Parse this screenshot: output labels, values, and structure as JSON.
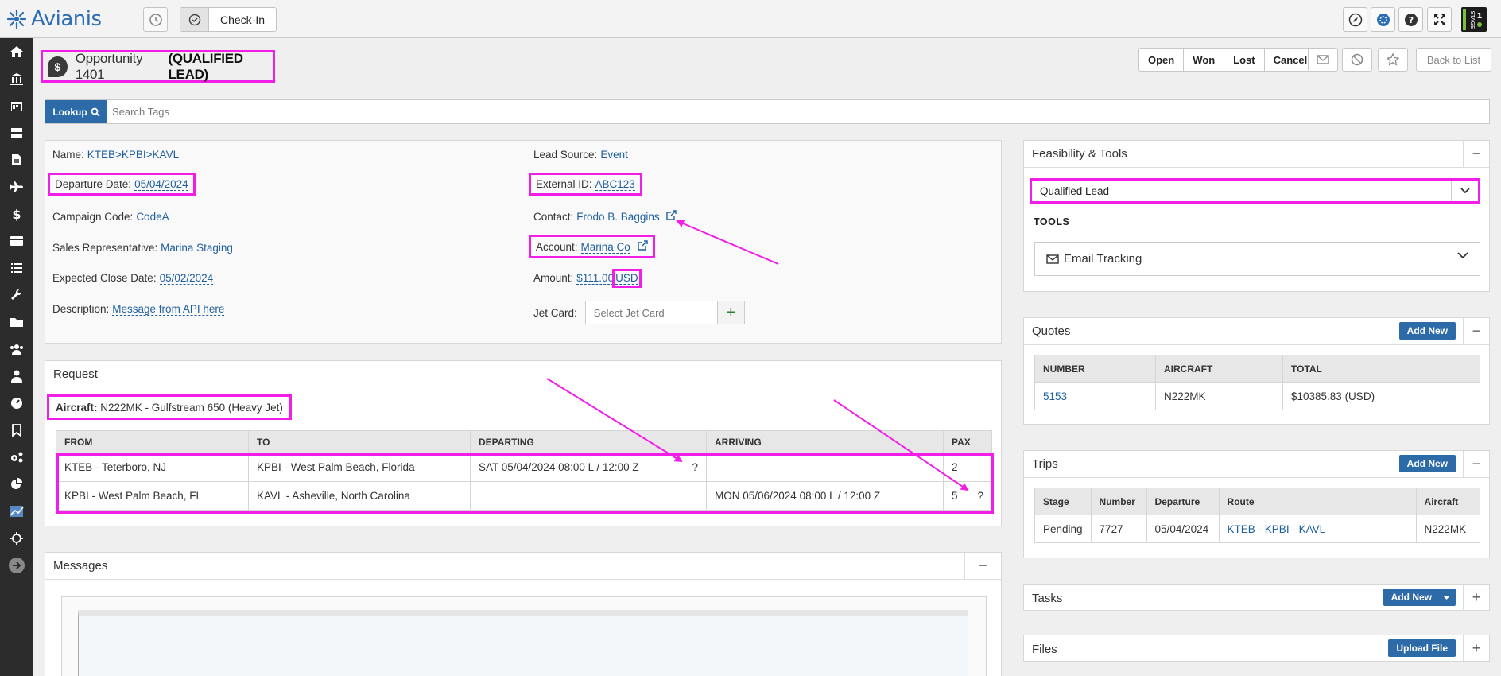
{
  "app": {
    "brand": "Avianis",
    "checkin_tab": "Check-In",
    "stage_badge": "STAGE",
    "stage_badge_number": "1"
  },
  "header": {
    "title_prefix": "Opportunity 1401",
    "title_status": "(QUALIFIED LEAD)",
    "status_buttons": [
      "Open",
      "Won",
      "Lost",
      "Cancel"
    ],
    "back_label": "Back to List"
  },
  "search": {
    "lookup_label": "Lookup",
    "placeholder": "Search Tags"
  },
  "details": {
    "name": {
      "label": "Name:",
      "value": "KTEB>KPBI>KAVL"
    },
    "departure_date": {
      "label": "Departure Date:",
      "value": "05/04/2024"
    },
    "campaign_code": {
      "label": "Campaign Code:",
      "value": "CodeA"
    },
    "sales_rep": {
      "label": "Sales Representative:",
      "value": "Marina Staging"
    },
    "expected_close": {
      "label": "Expected Close Date:",
      "value": "05/02/2024"
    },
    "description": {
      "label": "Description:",
      "value": "Message from API here"
    },
    "lead_source": {
      "label": "Lead Source:",
      "value": "Event"
    },
    "external_id": {
      "label": "External ID:",
      "value": "ABC123"
    },
    "contact": {
      "label": "Contact:",
      "value": "Frodo B. Baggins"
    },
    "account": {
      "label": "Account:",
      "value": "Marina Co"
    },
    "amount": {
      "label": "Amount:",
      "value": "$111.00",
      "currency": "USD"
    },
    "jet_card": {
      "label": "Jet Card:",
      "placeholder": "Select Jet Card"
    }
  },
  "request": {
    "title": "Request",
    "aircraft_label": "Aircraft:",
    "aircraft_value": "N222MK - Gulfstream 650 (Heavy Jet)",
    "columns": [
      "FROM",
      "TO",
      "DEPARTING",
      "ARRIVING",
      "PAX"
    ],
    "rows": [
      {
        "from": "KTEB - Teterboro, NJ",
        "to": "KPBI - West Palm Beach, Florida",
        "departing": "SAT 05/04/2024 08:00 L / 12:00 Z",
        "departing_flag": "?",
        "arriving": "",
        "pax": "2",
        "pax_flag": ""
      },
      {
        "from": "KPBI - West Palm Beach, FL",
        "to": "KAVL - Asheville, North Carolina",
        "departing": "",
        "departing_flag": "",
        "arriving": "MON 05/06/2024 08:00 L / 12:00 Z",
        "pax": "5",
        "pax_flag": "?"
      }
    ]
  },
  "messages": {
    "title": "Messages"
  },
  "feasibility": {
    "title": "Feasibility & Tools",
    "selected": "Qualified Lead",
    "tools_label": "TOOLS",
    "email_tracking": "Email Tracking"
  },
  "quotes": {
    "title": "Quotes",
    "add_label": "Add New",
    "columns": [
      "NUMBER",
      "AIRCRAFT",
      "TOTAL"
    ],
    "rows": [
      {
        "number": "5153",
        "aircraft": "N222MK",
        "total": "$10385.83 (USD)"
      }
    ]
  },
  "trips": {
    "title": "Trips",
    "add_label": "Add New",
    "columns": [
      "Stage",
      "Number",
      "Departure",
      "Route",
      "Aircraft"
    ],
    "rows": [
      {
        "stage": "Pending",
        "number": "7727",
        "departure": "05/04/2024",
        "route": "KTEB - KPBI - KAVL",
        "aircraft": "N222MK"
      }
    ]
  },
  "tasks": {
    "title": "Tasks",
    "add_label": "Add New"
  },
  "files": {
    "title": "Files",
    "upload_label": "Upload File"
  },
  "colors": {
    "highlight": "#f21ee8",
    "primary": "#2d6aa8",
    "sidebar": "#2c2c2c"
  }
}
